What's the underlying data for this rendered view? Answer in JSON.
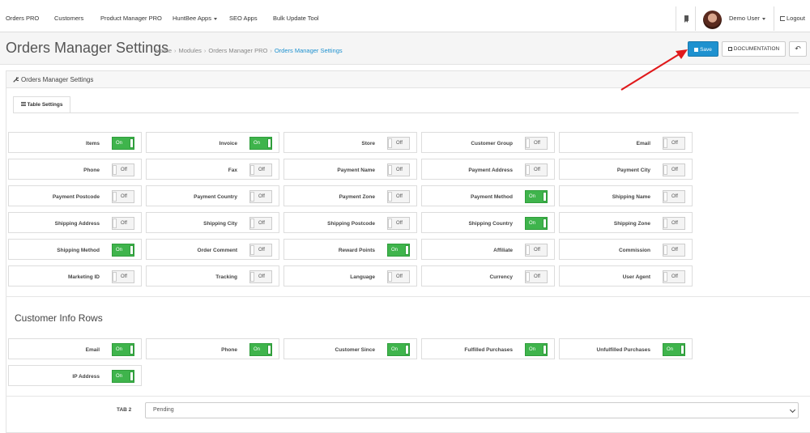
{
  "topnav": {
    "items": [
      "Orders PRO",
      "Customers",
      "Product Manager PRO",
      "HuntBee Apps",
      "SEO Apps",
      "Bulk Update Tool"
    ],
    "user_name": "Demo User",
    "logout_label": "Logout"
  },
  "header": {
    "title": "Orders Manager Settings",
    "breadcrumb": [
      "Home",
      "Modules",
      "Orders Manager PRO",
      "Orders Manager Settings"
    ],
    "breadcrumb_sep": "›",
    "save_label": "Save",
    "documentation_label": "DOCUMENTATION",
    "back_icon": "↶"
  },
  "panel": {
    "title": "Orders Manager Settings",
    "tab_label": "Table Settings"
  },
  "toggle_text": {
    "on": "On",
    "off": "Off"
  },
  "table_settings": [
    {
      "label": "Items",
      "state": "on"
    },
    {
      "label": "Invoice",
      "state": "on"
    },
    {
      "label": "Store",
      "state": "off"
    },
    {
      "label": "Customer Group",
      "state": "off"
    },
    {
      "label": "Email",
      "state": "off"
    },
    {
      "label": "Phone",
      "state": "off"
    },
    {
      "label": "Fax",
      "state": "off"
    },
    {
      "label": "Payment Name",
      "state": "off"
    },
    {
      "label": "Payment Address",
      "state": "off"
    },
    {
      "label": "Payment City",
      "state": "off"
    },
    {
      "label": "Payment Postcode",
      "state": "off"
    },
    {
      "label": "Payment Country",
      "state": "off"
    },
    {
      "label": "Payment Zone",
      "state": "off"
    },
    {
      "label": "Payment Method",
      "state": "on"
    },
    {
      "label": "Shipping Name",
      "state": "off"
    },
    {
      "label": "Shipping Address",
      "state": "off"
    },
    {
      "label": "Shipping City",
      "state": "off"
    },
    {
      "label": "Shipping Postcode",
      "state": "off"
    },
    {
      "label": "Shipping Country",
      "state": "on"
    },
    {
      "label": "Shipping Zone",
      "state": "off"
    },
    {
      "label": "Shipping Method",
      "state": "on"
    },
    {
      "label": "Order Comment",
      "state": "off"
    },
    {
      "label": "Reward Points",
      "state": "on"
    },
    {
      "label": "Affiliate",
      "state": "off"
    },
    {
      "label": "Commission",
      "state": "off"
    },
    {
      "label": "Marketing ID",
      "state": "off"
    },
    {
      "label": "Tracking",
      "state": "off"
    },
    {
      "label": "Language",
      "state": "off"
    },
    {
      "label": "Currency",
      "state": "off"
    },
    {
      "label": "User Agent",
      "state": "off"
    }
  ],
  "customer_info": {
    "title": "Customer Info Rows",
    "rows": [
      {
        "label": "Email",
        "state": "on"
      },
      {
        "label": "Phone",
        "state": "on"
      },
      {
        "label": "Customer Since",
        "state": "on"
      },
      {
        "label": "Fulfilled Purchases",
        "state": "on"
      },
      {
        "label": "Unfulfilled Purchases",
        "state": "on"
      },
      {
        "label": "IP Address",
        "state": "on"
      }
    ]
  },
  "tab2": {
    "label": "TAB 2",
    "selected": "Pending"
  },
  "colors": {
    "primary": "#1e91cf",
    "toggle_on": "#3fb44c",
    "annotation": "#e0191b"
  }
}
